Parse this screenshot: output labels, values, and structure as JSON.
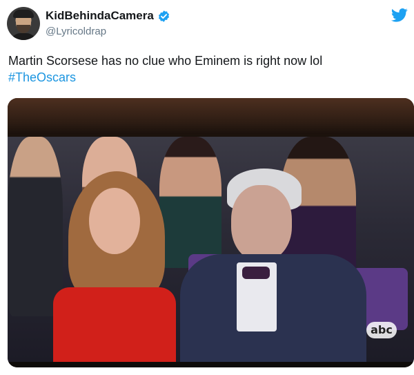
{
  "user": {
    "display_name": "KidBehindaCamera",
    "handle": "@Lyricoldrap",
    "verified": true,
    "avatar_icon": "avatar-photo"
  },
  "platform_icon": "twitter-bird-icon",
  "tweet": {
    "text": "Martin Scorsese has no clue who Eminem is right now lol",
    "hashtag": "#TheOscars"
  },
  "media": {
    "overlay_logo": "abc"
  },
  "colors": {
    "verified": "#1da1f2",
    "hashtag": "#1b95e0",
    "bird": "#1da1f2",
    "handle": "#657786"
  }
}
